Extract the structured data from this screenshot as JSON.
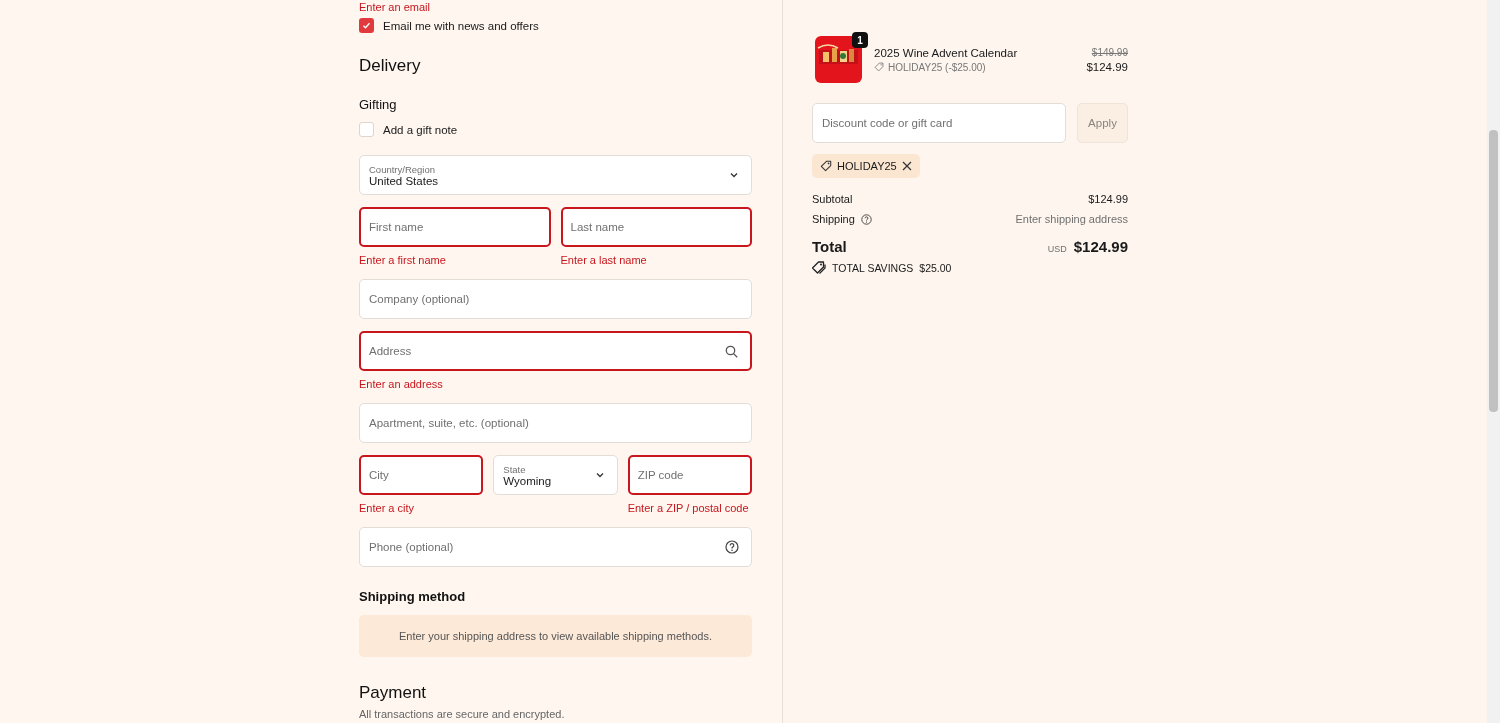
{
  "contact": {
    "email_error": "Enter an email",
    "newsletter": {
      "label": "Email me with news and offers",
      "checked": true
    }
  },
  "delivery": {
    "title": "Delivery",
    "gifting_title": "Gifting",
    "gift_note": {
      "label": "Add a gift note",
      "checked": false
    },
    "rows": [
      [
        {
          "kind": "select",
          "label": "Country/Region",
          "value": "United States"
        }
      ],
      [
        {
          "kind": "text",
          "placeholder": "First name",
          "invalid": true,
          "error": "Enter a first name"
        },
        {
          "kind": "text",
          "placeholder": "Last name",
          "invalid": true,
          "error": "Enter a last name"
        }
      ],
      [
        {
          "kind": "text",
          "placeholder": "Company (optional)",
          "invalid": false
        }
      ],
      [
        {
          "kind": "search",
          "placeholder": "Address",
          "invalid": true,
          "error": "Enter an address"
        }
      ],
      [
        {
          "kind": "text",
          "placeholder": "Apartment, suite, etc. (optional)",
          "invalid": false
        }
      ],
      [
        {
          "kind": "text",
          "placeholder": "City",
          "invalid": true,
          "error": "Enter a city"
        },
        {
          "kind": "select",
          "label": "State",
          "value": "Wyoming"
        },
        {
          "kind": "text",
          "placeholder": "ZIP code",
          "invalid": true,
          "error": "Enter a ZIP / postal code"
        }
      ],
      [
        {
          "kind": "help",
          "placeholder": "Phone (optional)",
          "invalid": false
        }
      ]
    ]
  },
  "shipping_method": {
    "title": "Shipping method",
    "notice": "Enter your shipping address to view available shipping methods."
  },
  "payment": {
    "title": "Payment",
    "subtitle": "All transactions are secure and encrypted."
  },
  "summary": {
    "item": {
      "kind": "picture",
      "quantity": "1",
      "name": "2025 Wine Advent Calendar",
      "discount": "HOLIDAY25 (-$25.00)",
      "original_price": "$149.99",
      "price": "$124.99"
    },
    "discount_field": {
      "placeholder": "Discount code or gift card"
    },
    "apply_button": {
      "label": "Apply",
      "disabled": true
    },
    "applied_codes": [
      {
        "code": "HOLIDAY25"
      }
    ],
    "subtotal": {
      "label": "Subtotal",
      "value": "$124.99"
    },
    "shipping": {
      "label": "Shipping",
      "value": "Enter shipping address"
    },
    "total": {
      "label": "Total",
      "currency": "USD",
      "value": "$124.99"
    },
    "savings": {
      "label": "TOTAL SAVINGS",
      "value": "$25.00"
    }
  }
}
